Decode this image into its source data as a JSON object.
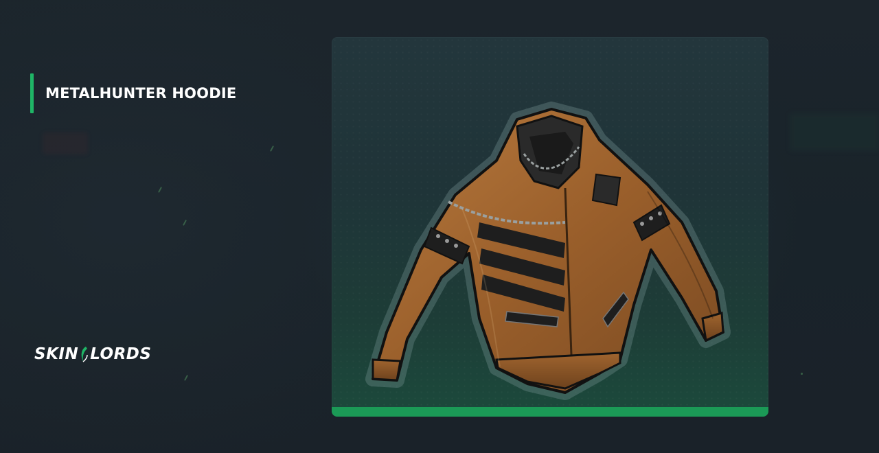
{
  "item": {
    "title": "METALHUNTER HOODIE"
  },
  "brand": {
    "part1": "SKIN",
    "part2": "LORDS"
  },
  "colors": {
    "accent": "#1fb566",
    "card_bar": "#1b9a56",
    "background": "#1b242b"
  },
  "icons": {
    "hoodie": "hoodie-item-image",
    "logo_mark": "skinlords-logo-mark"
  }
}
